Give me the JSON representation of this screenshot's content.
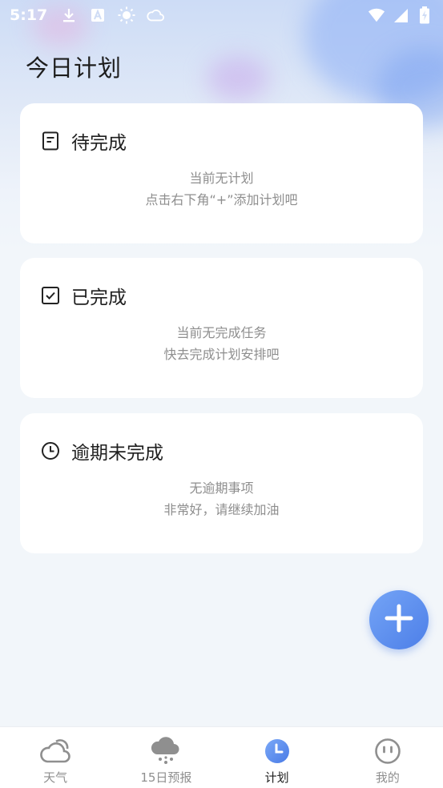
{
  "status_bar": {
    "time": "5:17",
    "left_icons": [
      "download-icon",
      "text-a-icon",
      "sun-icon",
      "cloud-icon"
    ],
    "right_icons": [
      "wifi-icon",
      "signal-icon",
      "battery-charging-icon"
    ]
  },
  "page": {
    "title": "今日计划"
  },
  "cards": [
    {
      "icon": "note-icon",
      "title": "待完成",
      "line1": "当前无计划",
      "line2": "点击右下角“+”添加计划吧"
    },
    {
      "icon": "checkbox-icon",
      "title": "已完成",
      "line1": "当前无完成任务",
      "line2": "快去完成计划安排吧"
    },
    {
      "icon": "clock-icon",
      "title": "逾期未完成",
      "line1": "无逾期事项",
      "line2": "非常好，请继续加油"
    }
  ],
  "fab": {
    "icon": "plus-icon"
  },
  "tabs": [
    {
      "label": "天气",
      "icon": "cloud-icon",
      "active": false
    },
    {
      "label": "15日预报",
      "icon": "rain-cloud-icon",
      "active": false
    },
    {
      "label": "计划",
      "icon": "clock-icon",
      "active": true
    },
    {
      "label": "我的",
      "icon": "face-icon",
      "active": false
    }
  ],
  "colors": {
    "accent": "#4d7fe8",
    "background": "#f2f6fa"
  }
}
